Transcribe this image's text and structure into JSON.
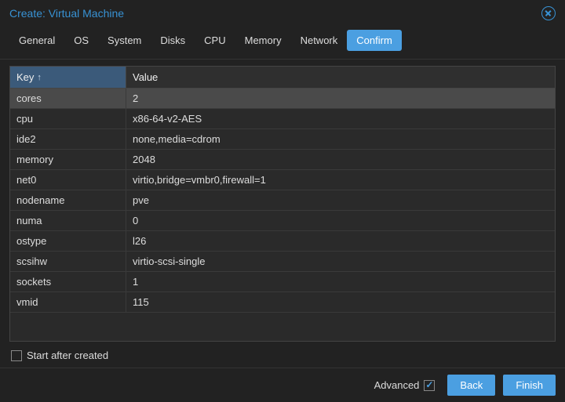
{
  "window": {
    "title": "Create: Virtual Machine"
  },
  "tabs": {
    "general": "General",
    "os": "OS",
    "system": "System",
    "disks": "Disks",
    "cpu": "CPU",
    "memory": "Memory",
    "network": "Network",
    "confirm": "Confirm"
  },
  "grid": {
    "header_key": "Key",
    "header_value": "Value",
    "sort_arrow": "↑",
    "rows": [
      {
        "key": "cores",
        "value": "2"
      },
      {
        "key": "cpu",
        "value": "x86-64-v2-AES"
      },
      {
        "key": "ide2",
        "value": "none,media=cdrom"
      },
      {
        "key": "memory",
        "value": "2048"
      },
      {
        "key": "net0",
        "value": "virtio,bridge=vmbr0,firewall=1"
      },
      {
        "key": "nodename",
        "value": "pve"
      },
      {
        "key": "numa",
        "value": "0"
      },
      {
        "key": "ostype",
        "value": "l26"
      },
      {
        "key": "scsihw",
        "value": "virtio-scsi-single"
      },
      {
        "key": "sockets",
        "value": "1"
      },
      {
        "key": "vmid",
        "value": "115"
      }
    ]
  },
  "below": {
    "start_after_created": "Start after created"
  },
  "footer": {
    "advanced": "Advanced",
    "back": "Back",
    "finish": "Finish"
  }
}
